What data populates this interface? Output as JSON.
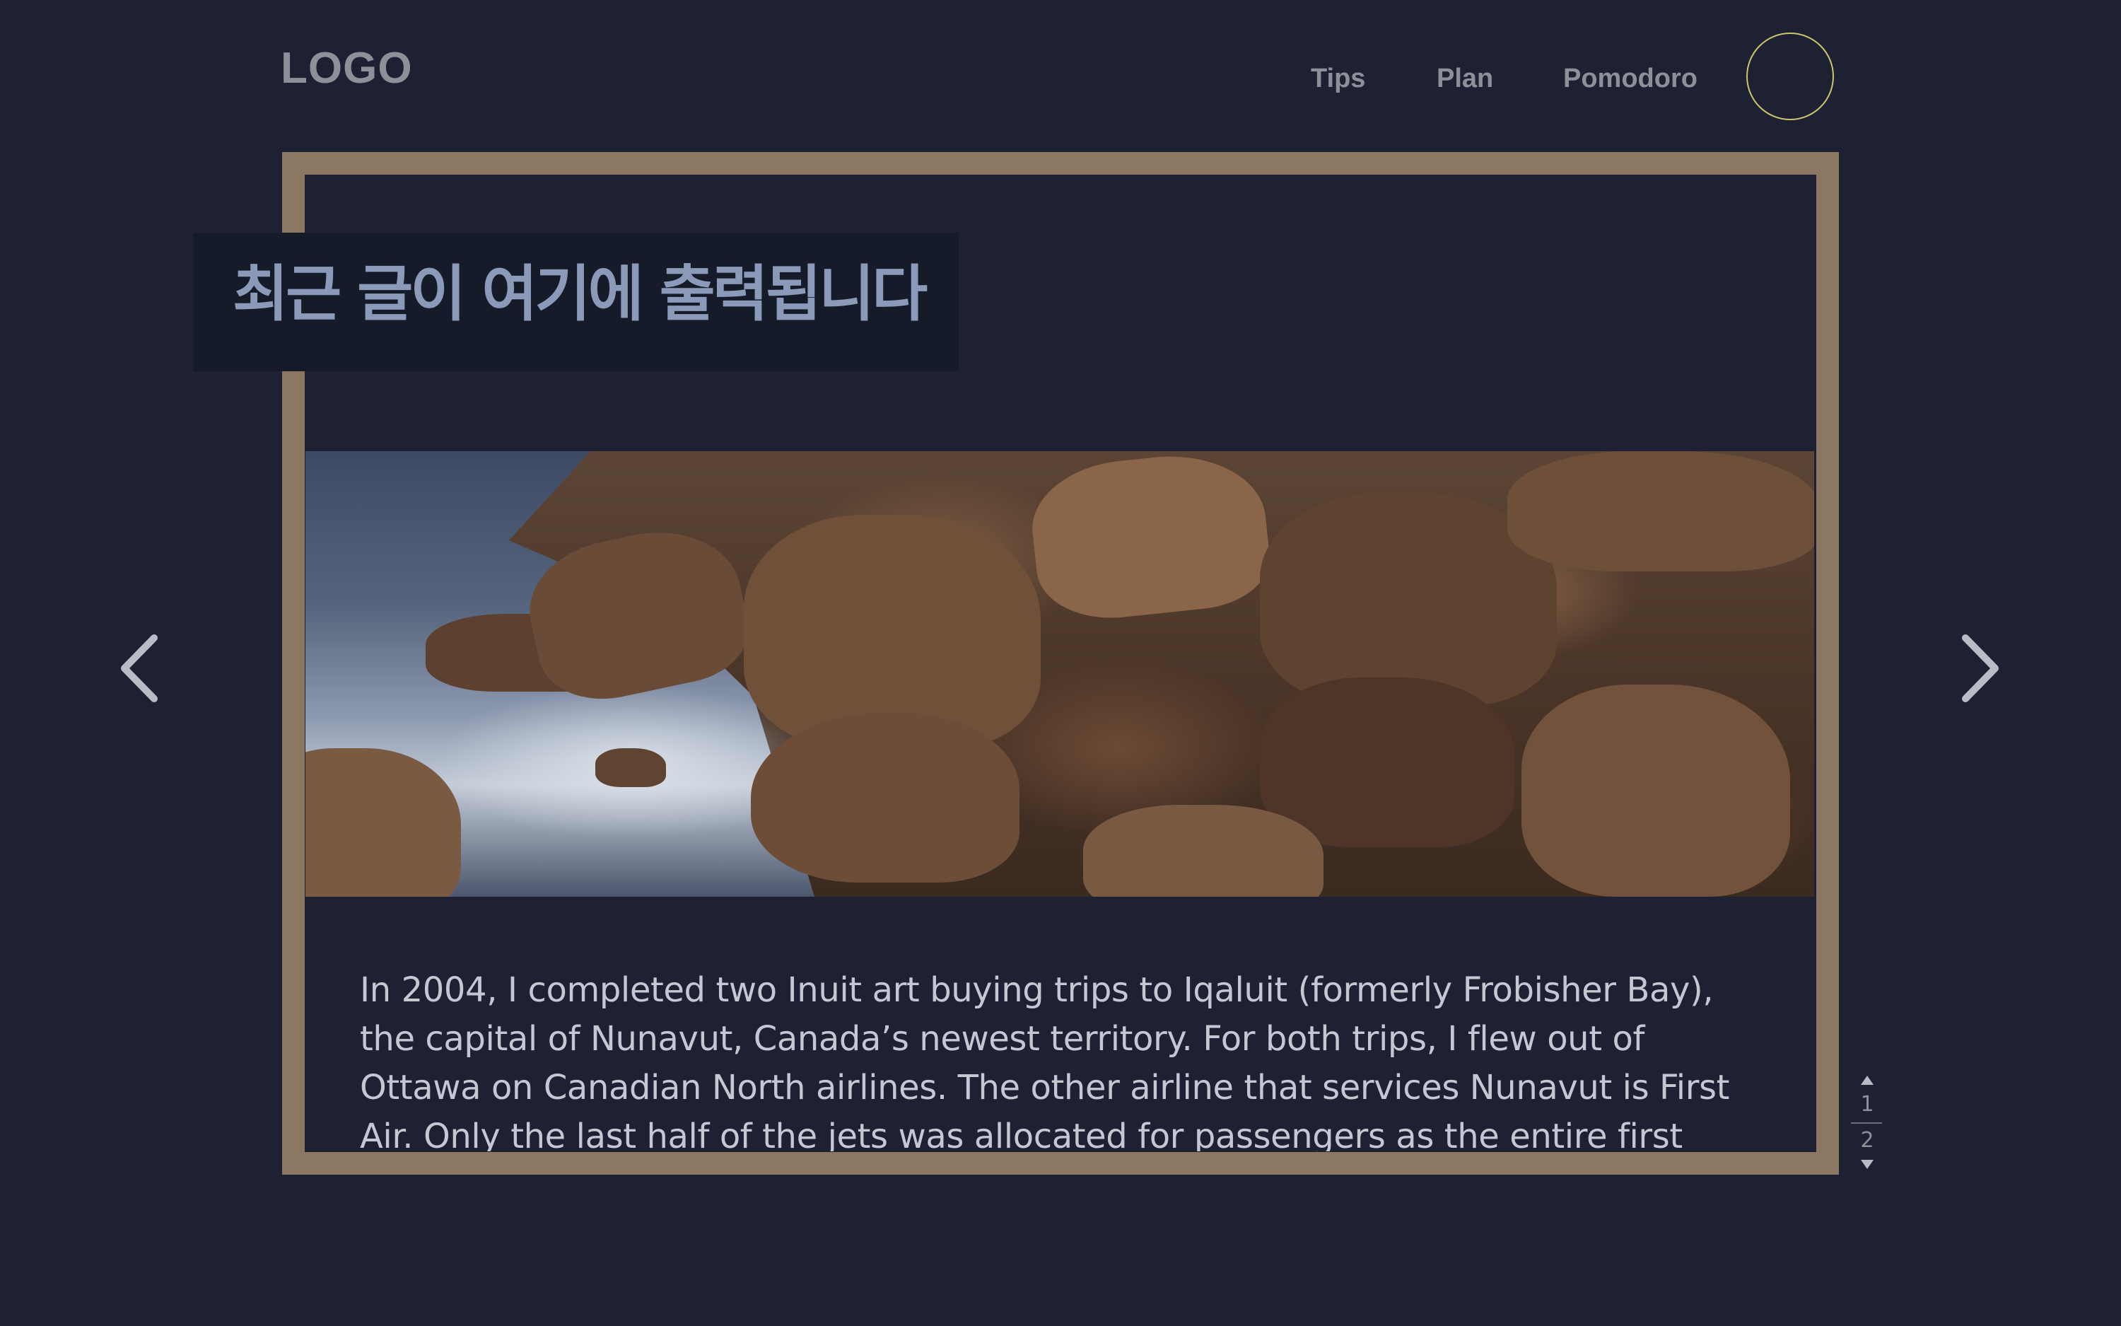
{
  "header": {
    "logo": "LOGO",
    "nav": [
      {
        "label": "Tips"
      },
      {
        "label": "Plan"
      },
      {
        "label": "Pomodoro"
      }
    ],
    "avatar_icon": "circle-avatar-icon"
  },
  "post": {
    "title": "최근 글이 여기에 출력됩니다",
    "image_icon": "rocky-coast-photo",
    "body_lines": [
      "In 2004, I completed two Inuit art buying trips to Iqaluit (formerly Frobisher Bay),",
      "the capital of Nunavut, Canada’s newest territory. For both trips, I flew out of",
      "Ottawa on Canadian North airlines. The other airline that services Nunavut is First",
      "Air. Only the last half of the jets was allocated for passengers as the entire first"
    ]
  },
  "carousel": {
    "prev_icon": "chevron-left-icon",
    "next_icon": "chevron-right-icon"
  },
  "pager": {
    "up_icon": "triangle-up-icon",
    "down_icon": "triangle-down-icon",
    "pages": [
      "1",
      "2"
    ]
  },
  "colors": {
    "background": "#1e2033",
    "frame": "#8b7762",
    "title_box": "#161b29",
    "title_text": "#8a9ab8",
    "nav_text": "#8d8f99",
    "avatar_ring": "#cbc66b",
    "body_text": "#c5c8d3"
  }
}
